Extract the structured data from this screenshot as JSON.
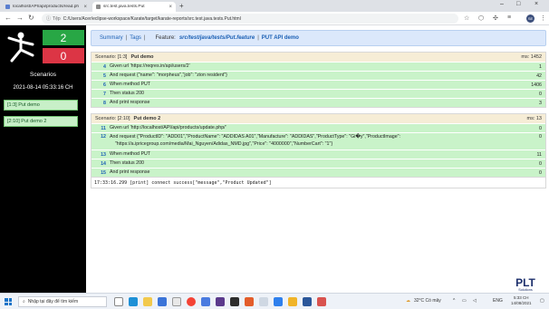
{
  "browser": {
    "tabs": [
      {
        "title": "localhost/API/api/products/read.ph",
        "active": false
      },
      {
        "title": "src.test.java.tests.Put",
        "active": true
      }
    ],
    "address": {
      "security_text": "Tệp",
      "url": "C:/Users/Acer/eclipse-workspace/Karate/target/karate-reports/src.test.java.tests.Put.html"
    },
    "profile_initials": "SE"
  },
  "sidebar": {
    "passed_count": "2",
    "failed_count": "0",
    "scenarios_label": "Scenarios",
    "timestamp": "2021-08-14 05:33:16 CH",
    "items": [
      {
        "label": "[1:3] Put demo"
      },
      {
        "label": "[2:10] Put demo 2"
      }
    ]
  },
  "topnav": {
    "summary_link": "Summary",
    "tags_link": "Tags",
    "feature_label": "Feature:",
    "feature_path": "src/test/java/tests/Put.feature",
    "feature_name": "PUT API demo"
  },
  "scenarios": [
    {
      "ref": "Scenario: [1:3]",
      "name": "Put demo",
      "ms": "ms: 1452",
      "steps": [
        {
          "line": "4",
          "text": "Given url 'https://reqres.in/api/users/2'",
          "value": "1"
        },
        {
          "line": "5",
          "text": "And request {\"name\": \"morpheus\",\"job\": \"zion resident\"}",
          "value": "42"
        },
        {
          "line": "6",
          "text": "When method PUT",
          "value": "1406"
        },
        {
          "line": "7",
          "text": "Then status 200",
          "value": "0"
        },
        {
          "line": "8",
          "text": "And print response",
          "value": "3"
        }
      ]
    },
    {
      "ref": "Scenario: [2:10]",
      "name": "Put demo 2",
      "ms": "ms: 13",
      "steps": [
        {
          "line": "11",
          "text": "Given url 'http://localhost/API/api/products/update.php/'",
          "value": "0"
        },
        {
          "line": "12",
          "text": "And request {\"ProductID\": \"ADD01\",\"ProductName\": \"ADDIDAS A01\",\"Manufacture\": \"ADDIDAS\",\"ProductType\": \"Gi�y\",\"ProductImage\":\n    \"https://a.ipricegroup.com/media/Mai_Nguyen/Adidas_NMD.jpg\",\"Price\": \"4000000\",\"NumberCart\": \"1\"}",
          "value": "0"
        },
        {
          "line": "13",
          "text": "When method PUT",
          "value": "11"
        },
        {
          "line": "14",
          "text": "Then status 200",
          "value": "0"
        },
        {
          "line": "15",
          "text": "And print response",
          "value": "0"
        }
      ],
      "log": "17:33:16.299 [print] connect success[\"message\",\"Product Updated\"]"
    }
  ],
  "taskbar": {
    "search_placeholder": "Nhập tại đây để tìm kiếm",
    "weather": "32°C Có mây",
    "language": "ENG",
    "time": "5:33 CH",
    "date": "14/08/2021"
  },
  "watermark": {
    "logo_text": "PLT",
    "tagline": "Solutions"
  },
  "colors": {
    "pass": "#28a745",
    "fail": "#dc3545",
    "step_pass": "#c9f3c9",
    "scenario_header": "#f6edd6",
    "nav_bg": "#dbe8fb"
  }
}
